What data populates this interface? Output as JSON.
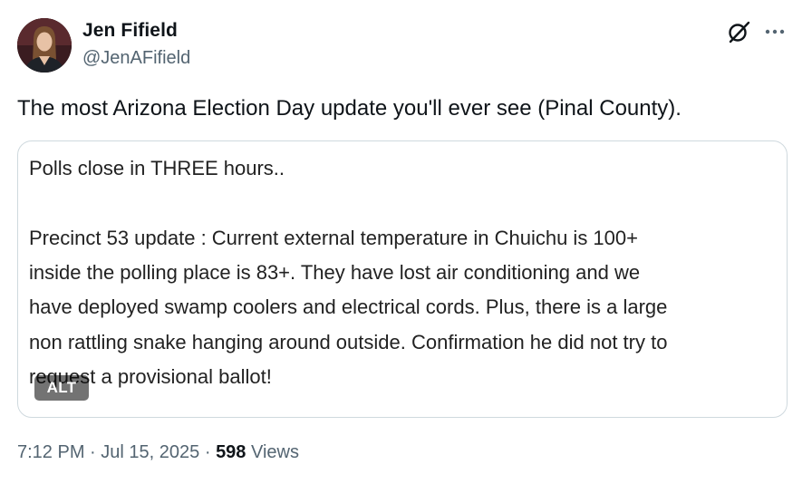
{
  "author": {
    "display_name": "Jen Fifield",
    "handle": "@JenAFifield"
  },
  "icons": {
    "avatar": "profile-photo",
    "grok": "grok-icon",
    "more": "more-options-icon"
  },
  "tweet": {
    "text": "The most Arizona Election Day update you'll ever see (Pinal County)."
  },
  "media": {
    "lines": [
      "Polls close in THREE hours..",
      "Precinct 53 update : Current external temperature in Chuichu is 100+",
      "inside the  polling place is 83+.  They have lost air conditioning and we",
      "have deployed swamp coolers and electrical cords.  Plus, there is a large",
      "non rattling snake hanging around outside. Confirmation he did not try to",
      "request a provisional ballot!"
    ],
    "alt_badge": "ALT"
  },
  "meta": {
    "time": "7:12 PM",
    "separator": "·",
    "date": "Jul 15, 2025",
    "views_count": "598",
    "views_label": "Views"
  },
  "colors": {
    "text_primary": "#0f1419",
    "text_secondary": "#536471",
    "card_border": "#cfd9de"
  }
}
